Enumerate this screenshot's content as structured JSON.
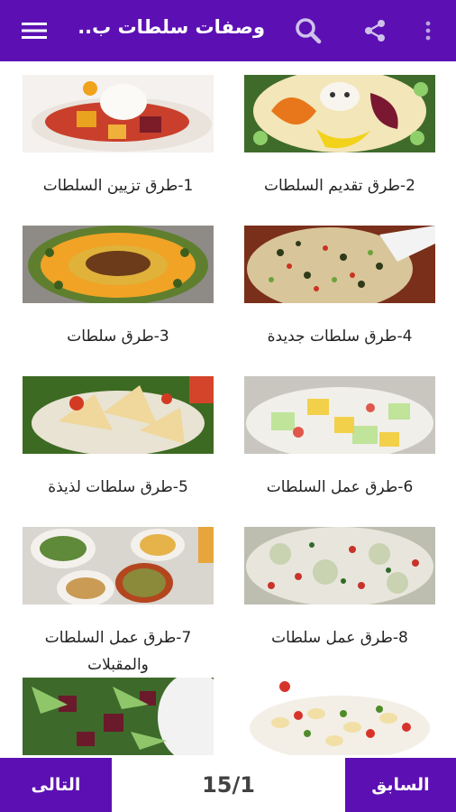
{
  "appbar": {
    "title": "وصفات سلطات ب..",
    "icons": {
      "more": "more-vert-icon",
      "share": "share-icon",
      "search": "search-icon",
      "menu": "hamburger-menu-icon"
    }
  },
  "items": [
    {
      "label": "1-طرق تزيين السلطات"
    },
    {
      "label": "2-طرق تقديم السلطات"
    },
    {
      "label": "3-طرق سلطات"
    },
    {
      "label": "4-طرق سلطات جديدة"
    },
    {
      "label": "5-طرق سلطات لذيذة"
    },
    {
      "label": "6-طرق عمل السلطات"
    },
    {
      "label": "7-طرق عمل السلطات والمقبلات"
    },
    {
      "label": "8-طرق عمل سلطات"
    },
    {
      "label": ""
    },
    {
      "label": ""
    }
  ],
  "pagination": {
    "next_label": "التالى",
    "prev_label": "السابق",
    "page_text": "15/1"
  },
  "colors": {
    "primary": "#5c10b4",
    "text": "#222222",
    "page_text": "#424242"
  }
}
